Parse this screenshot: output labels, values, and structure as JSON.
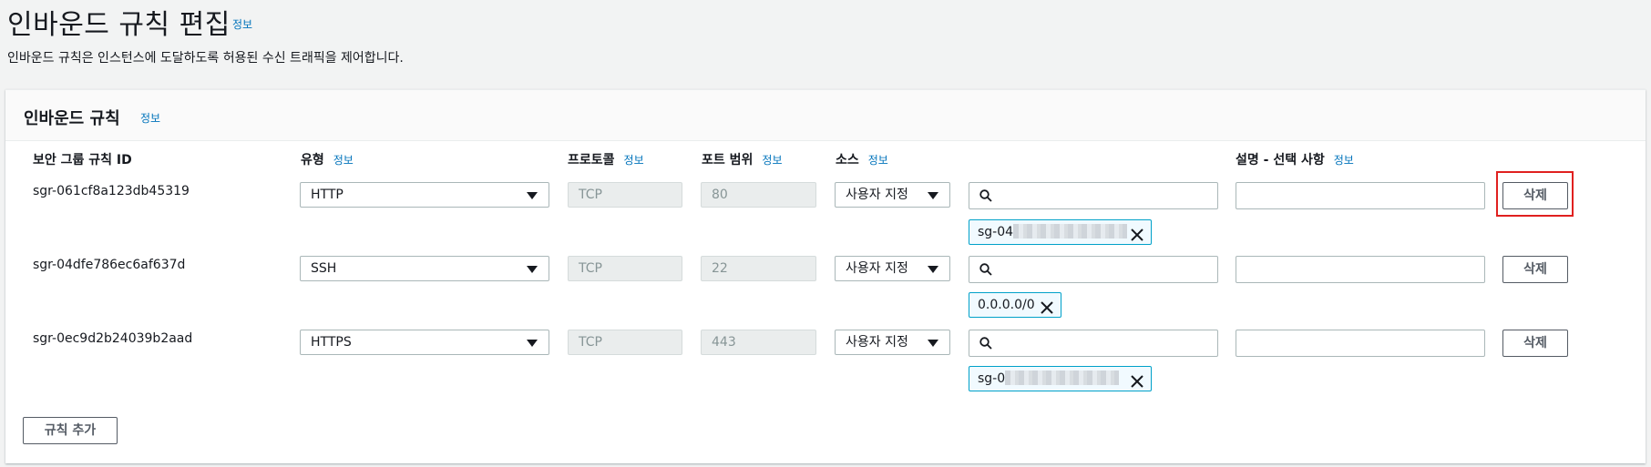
{
  "page": {
    "title": "인바운드 규칙 편집",
    "info": "정보",
    "description": "인바운드 규칙은 인스턴스에 도달하도록 허용된 수신 트래픽을 제어합니다."
  },
  "panel": {
    "title": "인바운드 규칙",
    "info": "정보"
  },
  "columns": {
    "rule_id": "보안 그룹 규칙 ID",
    "type": "유형",
    "protocol": "프로토콜",
    "port_range": "포트 범위",
    "source": "소스",
    "description": "설명 - 선택 사항",
    "info": "정보"
  },
  "rules": [
    {
      "id": "sgr-061cf8a123db45319",
      "type": "HTTP",
      "protocol": "TCP",
      "port": "80",
      "source_type": "사용자 지정",
      "source_token": "sg-04",
      "token_blurred": true,
      "delete_label": "삭제"
    },
    {
      "id": "sgr-04dfe786ec6af637d",
      "type": "SSH",
      "protocol": "TCP",
      "port": "22",
      "source_type": "사용자 지정",
      "source_token": "0.0.0.0/0",
      "token_blurred": false,
      "delete_label": "삭제"
    },
    {
      "id": "sgr-0ec9d2b24039b2aad",
      "type": "HTTPS",
      "protocol": "TCP",
      "port": "443",
      "source_type": "사용자 지정",
      "source_token": "sg-0",
      "token_blurred": true,
      "delete_label": "삭제"
    }
  ],
  "add_rule_label": "규칙 추가",
  "colors": {
    "link": "#0073bb",
    "token_border": "#00a1c9",
    "highlight": "#e0201f"
  }
}
